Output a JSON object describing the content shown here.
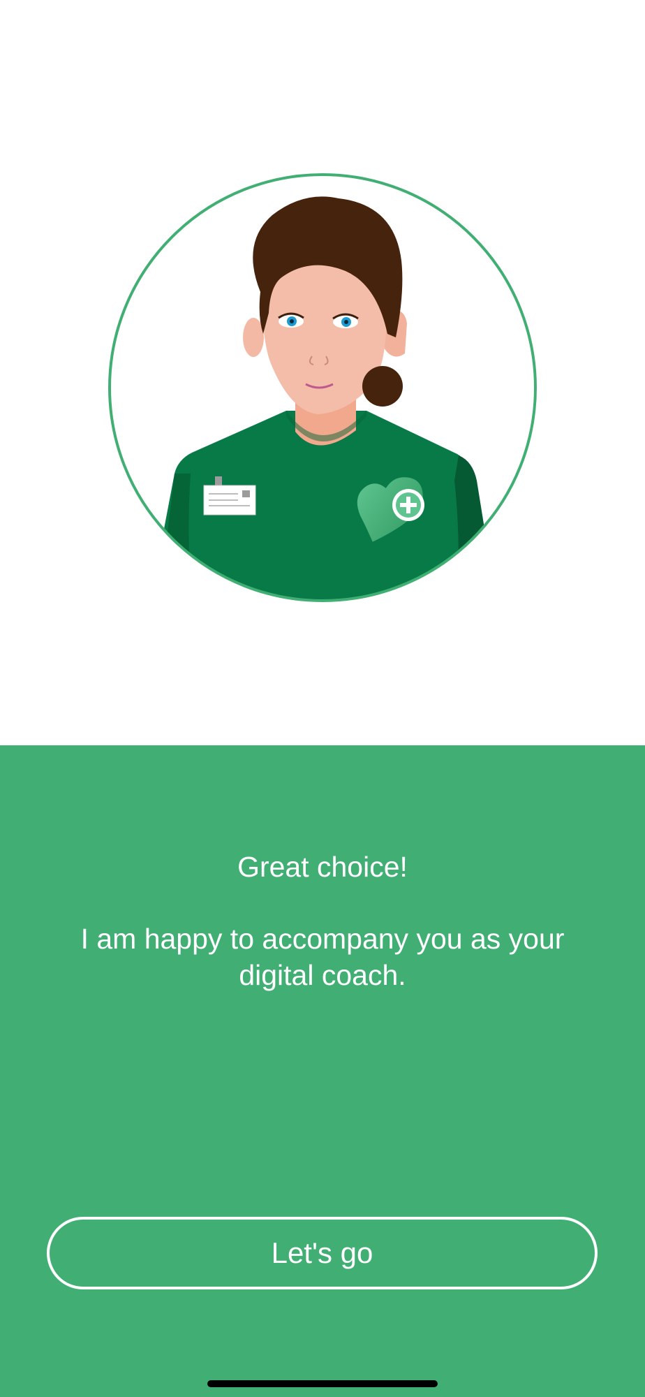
{
  "onboarding": {
    "headline": "Great choice!",
    "message": "I am happy to accompany you as your digital coach.",
    "cta_label": "Let's go"
  },
  "avatar": {
    "description_icon": "coach-avatar-icon",
    "ring_color": "#41af74",
    "shirt_color": "#087a47",
    "hair_color": "#45230d"
  },
  "colors": {
    "panel_background": "#41af74",
    "text": "#ffffff",
    "page_background": "#ffffff"
  }
}
